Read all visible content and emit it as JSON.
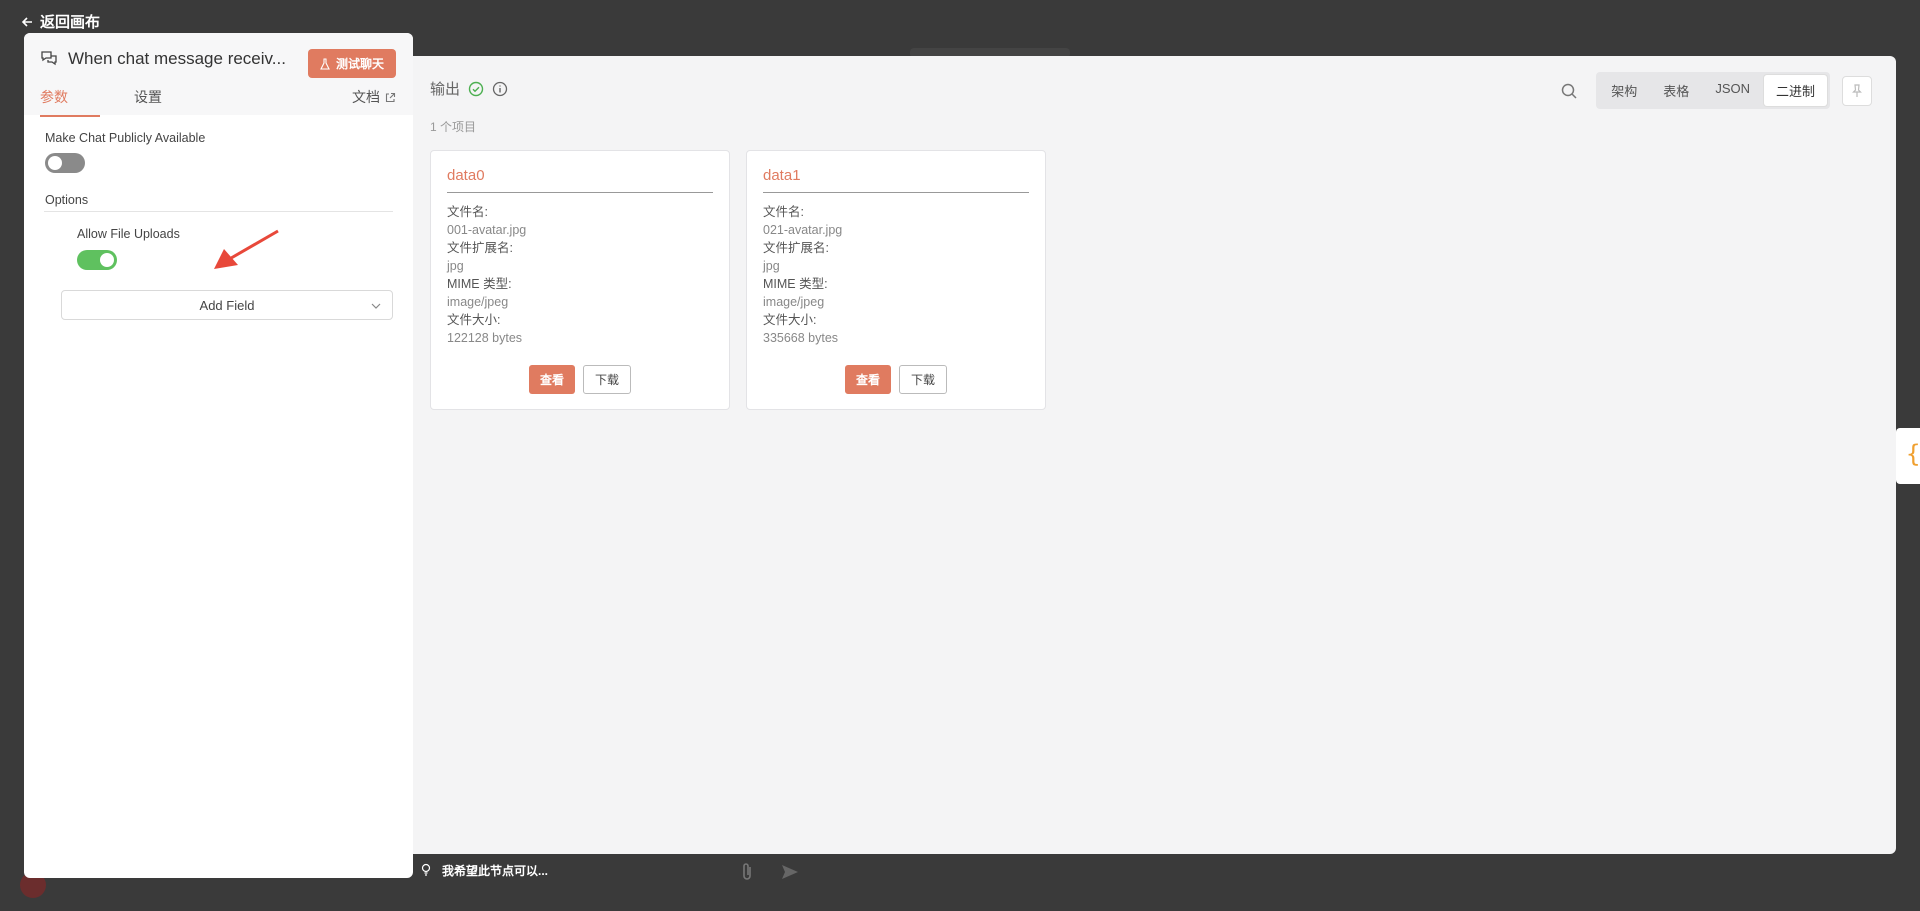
{
  "back_link": "返回画布",
  "node": {
    "title": "When chat message receiv...",
    "test_chat_label": "测试聊天",
    "tabs": [
      "参数",
      "设置"
    ],
    "docs_label": "文档",
    "params": {
      "make_public_label": "Make Chat Publicly Available",
      "make_public_value": false,
      "options_label": "Options",
      "allow_uploads_label": "Allow File Uploads",
      "allow_uploads_value": true,
      "add_field_label": "Add Field"
    }
  },
  "output": {
    "title": "输出",
    "item_count": "1 个项目",
    "view_tabs": [
      "架构",
      "表格",
      "JSON",
      "二进制"
    ],
    "active_view": "二进制",
    "cards": [
      {
        "name": "data0",
        "filename_label": "文件名:",
        "filename": "001-avatar.jpg",
        "ext_label": "文件扩展名:",
        "ext": "jpg",
        "mime_label": "MIME 类型:",
        "mime": "image/jpeg",
        "size_label": "文件大小:",
        "size": "122128 bytes",
        "view_label": "查看",
        "download_label": "下载"
      },
      {
        "name": "data1",
        "filename_label": "文件名:",
        "filename": "021-avatar.jpg",
        "ext_label": "文件扩展名:",
        "ext": "jpg",
        "mime_label": "MIME 类型:",
        "mime": "image/jpeg",
        "size_label": "文件大小:",
        "size": "335668 bytes",
        "view_label": "查看",
        "download_label": "下载"
      }
    ]
  },
  "chat_prompt": "我希望此节点可以...",
  "colors": {
    "accent": "#e07b60",
    "success": "#5fc15f",
    "annotation_arrow": "#e8483a"
  }
}
